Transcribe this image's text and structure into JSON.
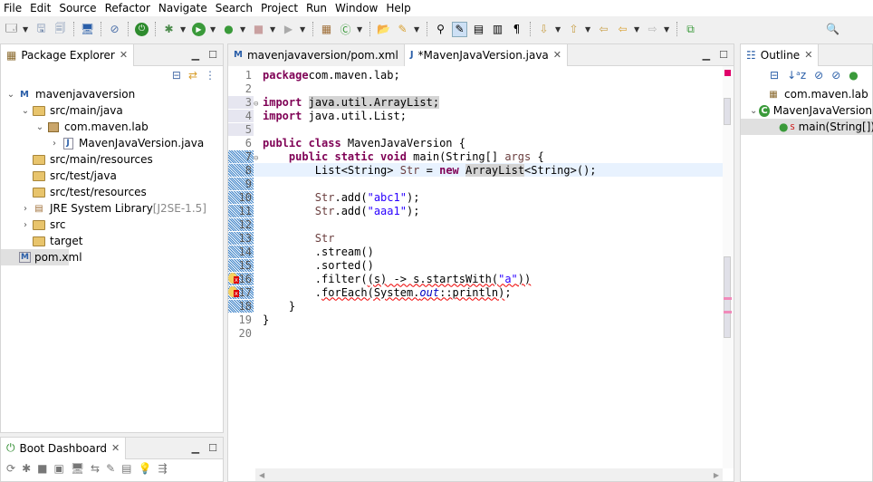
{
  "menu": [
    "File",
    "Edit",
    "Source",
    "Refactor",
    "Navigate",
    "Search",
    "Project",
    "Run",
    "Window",
    "Help"
  ],
  "package_explorer": {
    "title": "Package Explorer",
    "items": [
      {
        "label": "mavenjavaversion",
        "suffix": "",
        "depth": 0,
        "twisty": "v",
        "icon": "maven-project-icon"
      },
      {
        "label": "src/main/java",
        "suffix": "",
        "depth": 1,
        "twisty": "v",
        "icon": "source-folder-icon"
      },
      {
        "label": "com.maven.lab",
        "suffix": "",
        "depth": 2,
        "twisty": "v",
        "icon": "package-icon"
      },
      {
        "label": "MavenJavaVersion.java",
        "suffix": "",
        "depth": 3,
        "twisty": ">",
        "icon": "java-file-icon"
      },
      {
        "label": "src/main/resources",
        "suffix": "",
        "depth": 1,
        "twisty": "",
        "icon": "source-folder-icon"
      },
      {
        "label": "src/test/java",
        "suffix": "",
        "depth": 1,
        "twisty": "",
        "icon": "source-folder-icon"
      },
      {
        "label": "src/test/resources",
        "suffix": "",
        "depth": 1,
        "twisty": "",
        "icon": "source-folder-icon"
      },
      {
        "label": "JRE System Library",
        "suffix": " [J2SE-1.5]",
        "depth": 1,
        "twisty": ">",
        "icon": "library-icon"
      },
      {
        "label": "src",
        "suffix": "",
        "depth": 1,
        "twisty": ">",
        "icon": "folder-icon"
      },
      {
        "label": "target",
        "suffix": "",
        "depth": 1,
        "twisty": "",
        "icon": "folder-icon"
      },
      {
        "label": "pom.xml",
        "suffix": "",
        "depth": 1,
        "twisty": "",
        "icon": "xml-file-icon"
      }
    ]
  },
  "boot_dashboard": {
    "title": "Boot Dashboard"
  },
  "editor": {
    "tabs": [
      {
        "label": "mavenjavaversion/pom.xml",
        "active": false
      },
      {
        "label": "*MavenJavaVersion.java",
        "active": true
      }
    ],
    "lines": [
      [
        [
          "kw",
          "package"
        ],
        [
          "",
          "com.maven.lab;"
        ]
      ],
      [],
      [
        [
          "kw",
          "import"
        ],
        [
          "",
          " "
        ],
        [
          "hl",
          "java.util.ArrayList;"
        ]
      ],
      [
        [
          "kw",
          "import"
        ],
        [
          "",
          " java.util.List;"
        ]
      ],
      [],
      [
        [
          "kw",
          "public class"
        ],
        [
          "",
          " MavenJavaVersion {"
        ]
      ],
      [
        [
          "",
          "    "
        ],
        [
          "kw",
          "public static void"
        ],
        [
          "",
          " main(String[] "
        ],
        [
          "var",
          "args"
        ],
        [
          "",
          " {"
        ]
      ],
      [
        [
          "",
          "        List<String> "
        ],
        [
          "var",
          "Str"
        ],
        [
          "",
          " = "
        ],
        [
          "kw",
          "new"
        ],
        [
          "",
          " "
        ],
        [
          "hl",
          "ArrayList"
        ],
        [
          "",
          "<String>();"
        ]
      ],
      [],
      [
        [
          "",
          "        "
        ],
        [
          "var",
          "Str"
        ],
        [
          "",
          ".add("
        ],
        [
          "str",
          "\"abc1\""
        ],
        [
          "",
          ");"
        ]
      ],
      [
        [
          "",
          "        "
        ],
        [
          "var",
          "Str"
        ],
        [
          "",
          ".add("
        ],
        [
          "str",
          "\"aaa1\""
        ],
        [
          "",
          ");"
        ]
      ],
      [],
      [
        [
          "",
          "        "
        ],
        [
          "var",
          "Str"
        ]
      ],
      [
        [
          "",
          "        .stream()"
        ]
      ],
      [
        [
          "",
          "        .sorted()"
        ]
      ],
      [
        [
          "",
          "        .filter("
        ],
        [
          "err",
          "(s) -> s.startsWith("
        ],
        [
          "err str",
          "\"a\""
        ],
        [
          "err",
          "))"
        ]
      ],
      [
        [
          "",
          "        ."
        ],
        [
          "err",
          "forEach(System."
        ],
        [
          "err fieldi",
          "out"
        ],
        [
          "err",
          "::println)"
        ],
        [
          "",
          ";"
        ]
      ],
      [
        [
          "",
          "    }"
        ]
      ],
      [
        [
          "",
          "}"
        ]
      ],
      []
    ]
  },
  "outline": {
    "title": "Outline",
    "items": [
      {
        "label": "com.maven.lab",
        "depth": 0
      },
      {
        "label": "MavenJavaVersion",
        "depth": 0
      },
      {
        "label": "main(String[]) : void",
        "depth": 1
      }
    ]
  }
}
